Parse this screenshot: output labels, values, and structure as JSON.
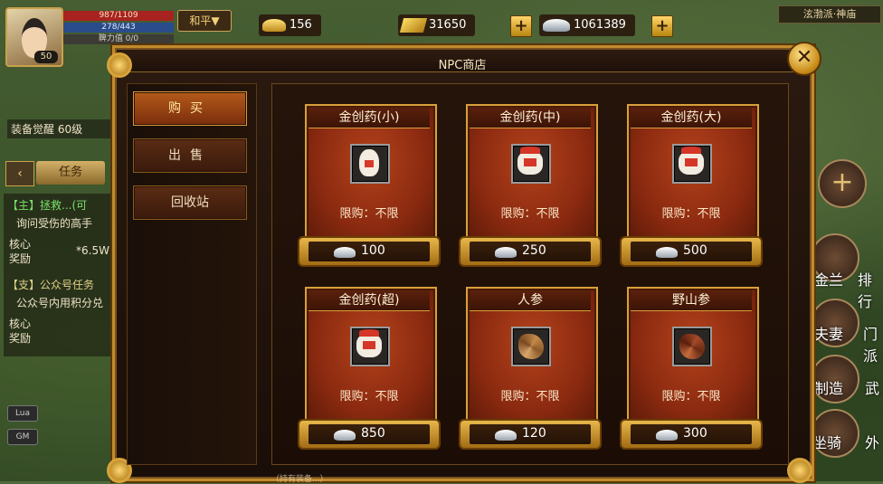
{
  "hud": {
    "level": "50",
    "hp": "987/1109",
    "mp": "278/443",
    "stamina": "聛力值 0/0",
    "mode": "和平▼",
    "currency": [
      {
        "name": "gold-ingot",
        "value": "156"
      },
      {
        "name": "gold-bars",
        "value": "31650"
      },
      {
        "name": "silver",
        "value": "1061389"
      }
    ],
    "zone": "泫渤派·神庙",
    "left": {
      "equip_awaken": "装备觉醒 60级",
      "task_tab": "任务",
      "quest1_title": "【主】拯救...(可",
      "quest1_desc": "询问受伤的高手",
      "quest1_reward_label": "核心\n奖励",
      "quest1_reward": "*6.5W",
      "quest2_title": "【支】公众号任务",
      "quest2_desc": "公众号内用积分兑",
      "quest2_reward_label": "核心\n奖励",
      "lua": "Lua",
      "gm": "GM"
    },
    "right": [
      "金兰",
      "排行",
      "夫妻",
      "门派",
      "制造",
      "武",
      "坐骑",
      "外"
    ]
  },
  "shop": {
    "title": "NPC商店",
    "tabs": [
      {
        "label": "购买",
        "active": true
      },
      {
        "label": "出售",
        "active": false
      },
      {
        "label": "回收站",
        "active": false
      }
    ],
    "limit_text": "限购：不限",
    "items": [
      {
        "name": "金创药(小)",
        "price": "100",
        "icon": "gourd-potion-icon"
      },
      {
        "name": "金创药(中)",
        "price": "250",
        "icon": "jar-potion-icon"
      },
      {
        "name": "金创药(大)",
        "price": "500",
        "icon": "jar-potion-icon"
      },
      {
        "name": "金创药(超)",
        "price": "850",
        "icon": "jar-potion-icon"
      },
      {
        "name": "人参",
        "price": "120",
        "icon": "ginseng-icon"
      },
      {
        "name": "野山参",
        "price": "300",
        "icon": "wild-ginseng-icon"
      }
    ],
    "bottom_hint": "（持有装备...）"
  },
  "colors": {
    "accent_gold": "#d9a03a",
    "card_red": "#8b2a10",
    "frame": "#c08b2c"
  }
}
